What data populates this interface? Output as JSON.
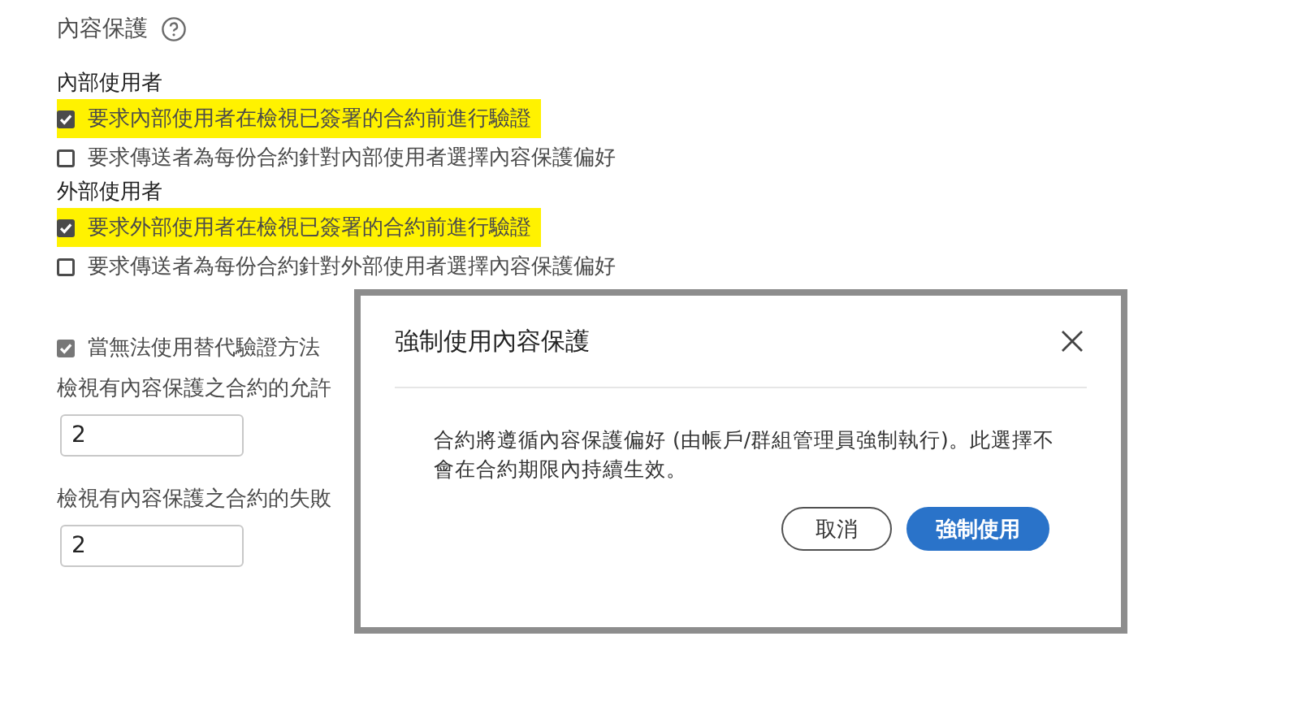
{
  "section_title": "內容保護",
  "groups": [
    {
      "heading": "內部使用者",
      "options": [
        {
          "label": "要求內部使用者在檢視已簽署的合約前進行驗證",
          "checked": true,
          "highlighted": true
        },
        {
          "label": "要求傳送者為每份合約針對內部使用者選擇內容保護偏好",
          "checked": false,
          "highlighted": false
        }
      ]
    },
    {
      "heading": "外部使用者",
      "options": [
        {
          "label": "要求外部使用者在檢視已簽署的合約前進行驗證",
          "checked": true,
          "highlighted": true
        },
        {
          "label": "要求傳送者為每份合約針對外部使用者選擇內容保護偏好",
          "checked": false,
          "highlighted": false
        }
      ]
    }
  ],
  "fallback_option": {
    "label": "當無法使用替代驗證方法",
    "checked": true
  },
  "fields": [
    {
      "label": "檢視有內容保護之合約的允許",
      "value": "2"
    },
    {
      "label": "檢視有內容保護之合約的失敗",
      "value": "2"
    }
  ],
  "dialog": {
    "title": "強制使用內容保護",
    "message": "合約將遵循內容保護偏好 (由帳戶/群組管理員強制執行)。此選擇不會在合約期限內持續生效。",
    "buttons": [
      {
        "label": "取消",
        "kind": "secondary"
      },
      {
        "label": "強制使用",
        "kind": "primary"
      }
    ]
  }
}
